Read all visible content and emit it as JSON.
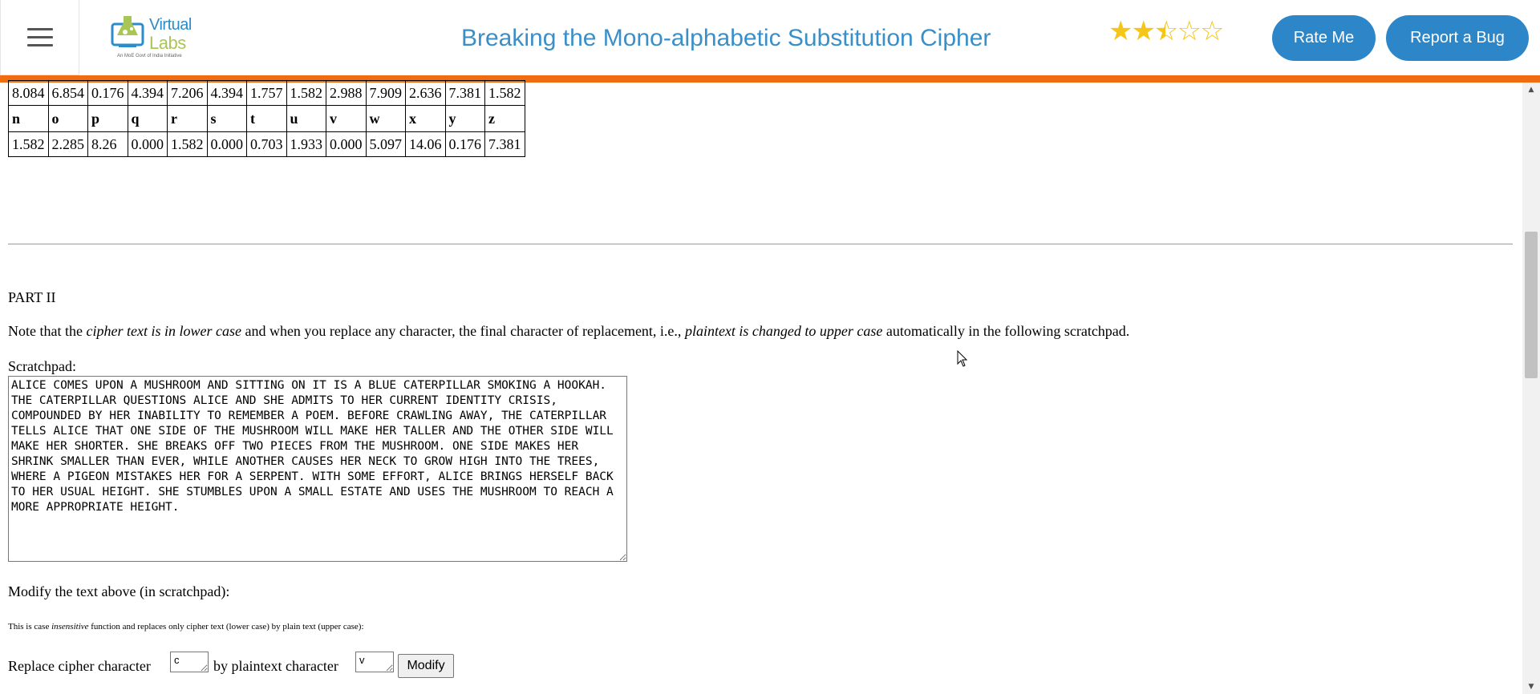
{
  "header": {
    "menu_icon": "hamburger-menu-icon",
    "logo_virtual": "Virtual",
    "logo_labs": "Labs",
    "logo_tagline": "An MoE Govt of India Initiative",
    "title": "Breaking the Mono-alphabetic Substitution Cipher",
    "rating": {
      "value": 2.5,
      "max": 5
    },
    "rate_button": "Rate Me",
    "bug_button": "Report a Bug",
    "accent_color": "#ef6c11",
    "button_color": "#2c86c8"
  },
  "freq_table": {
    "row_top_values": [
      "8.084",
      "6.854",
      "0.176",
      "4.394",
      "7.206",
      "4.394",
      "1.757",
      "1.582",
      "2.988",
      "7.909",
      "2.636",
      "7.381",
      "1.582"
    ],
    "letters": [
      "n",
      "o",
      "p",
      "q",
      "r",
      "s",
      "t",
      "u",
      "v",
      "w",
      "x",
      "y",
      "z"
    ],
    "values": [
      "1.582",
      "2.285",
      "8.26",
      "0.000",
      "1.582",
      "0.000",
      "0.703",
      "1.933",
      "0.000",
      "5.097",
      "14.06",
      "0.176",
      "7.381"
    ]
  },
  "part2": {
    "heading": "PART II",
    "note_pre": "Note that the ",
    "note_em1": "cipher text is in lower case",
    "note_mid": " and when you replace any character, the final character of replacement, i.e., ",
    "note_em2": "plaintext is changed to upper case",
    "note_post": " automatically in the following scratchpad.",
    "scratchpad_label": "Scratchpad:",
    "scratchpad_text": "ALICE COMES UPON A MUSHROOM AND SITTING ON IT IS A BLUE CATERPILLAR SMOKING A HOOKAH. THE CATERPILLAR QUESTIONS ALICE AND SHE ADMITS TO HER CURRENT IDENTITY CRISIS, COMPOUNDED BY HER INABILITY TO REMEMBER A POEM. BEFORE CRAWLING AWAY, THE CATERPILLAR TELLS ALICE THAT ONE SIDE OF THE MUSHROOM WILL MAKE HER TALLER AND THE OTHER SIDE WILL MAKE HER SHORTER. SHE BREAKS OFF TWO PIECES FROM THE MUSHROOM. ONE SIDE MAKES HER SHRINK SMALLER THAN EVER, WHILE ANOTHER CAUSES HER NECK TO GROW HIGH INTO THE TREES, WHERE A PIGEON MISTAKES HER FOR A SERPENT. WITH SOME EFFORT, ALICE BRINGS HERSELF BACK TO HER USUAL HEIGHT. SHE STUMBLES UPON A SMALL ESTATE AND USES THE MUSHROOM TO REACH A MORE APPROPRIATE HEIGHT.",
    "modify_label": "Modify the text above (in scratchpad):",
    "small_pre": "This is case ",
    "small_em": "insensitive",
    "small_post": " function and replaces only cipher text (lower case) by plain text (upper case):",
    "replace_label_1": "Replace cipher character",
    "cipher_char": "c",
    "replace_label_2": "by plaintext character",
    "plain_char": "v",
    "modify_button": "Modify"
  }
}
